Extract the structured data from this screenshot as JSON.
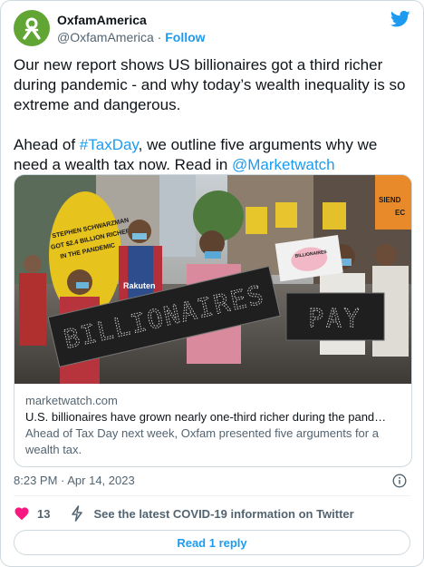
{
  "author": {
    "display_name": "OxfamAmerica",
    "handle": "@OxfamAmerica",
    "separator": " · ",
    "follow_label": "Follow",
    "avatar_color": "#61a534"
  },
  "tweet": {
    "line1": "Our new report shows US billionaires got a third richer during pandemic - and why today’s wealth inequality is so extreme and dangerous.",
    "line2_pre": "Ahead of ",
    "hashtag": "#TaxDay",
    "line2_mid": ", we outline five arguments why we need a wealth tax now. Read in ",
    "mention": "@Marketwatch"
  },
  "card": {
    "domain": "marketwatch.com",
    "headline": "U.S. billionaires have grown nearly one-third richer during the pand…",
    "description": "Ahead of Tax Day next week, Oxfam presented five arguments for a wealth tax.",
    "photo_signs": {
      "left_sign": "BILLIONAIRES",
      "right_sign": "PAY",
      "yellow_sign_line1": "STEPHEN SCHWARZMAN",
      "yellow_sign_line2": "GOT $2.4 BILLION RICHER",
      "yellow_sign_line3": "IN THE PANDEMIC",
      "shirt_text": "Rakuten",
      "pig_sign": "BILLIONAIRES"
    }
  },
  "meta": {
    "timestamp": "8:23 PM · Apr 14, 2023"
  },
  "actions": {
    "like_count": "13",
    "covid_info": "See the latest COVID-19 information on Twitter",
    "read_reply": "Read 1 reply"
  },
  "colors": {
    "accent": "#1d9bf0",
    "heart": "#f91880"
  },
  "icons": [
    "oxfam-logo-icon",
    "twitter-bird-icon",
    "info-icon",
    "heart-icon",
    "lightning-icon"
  ]
}
